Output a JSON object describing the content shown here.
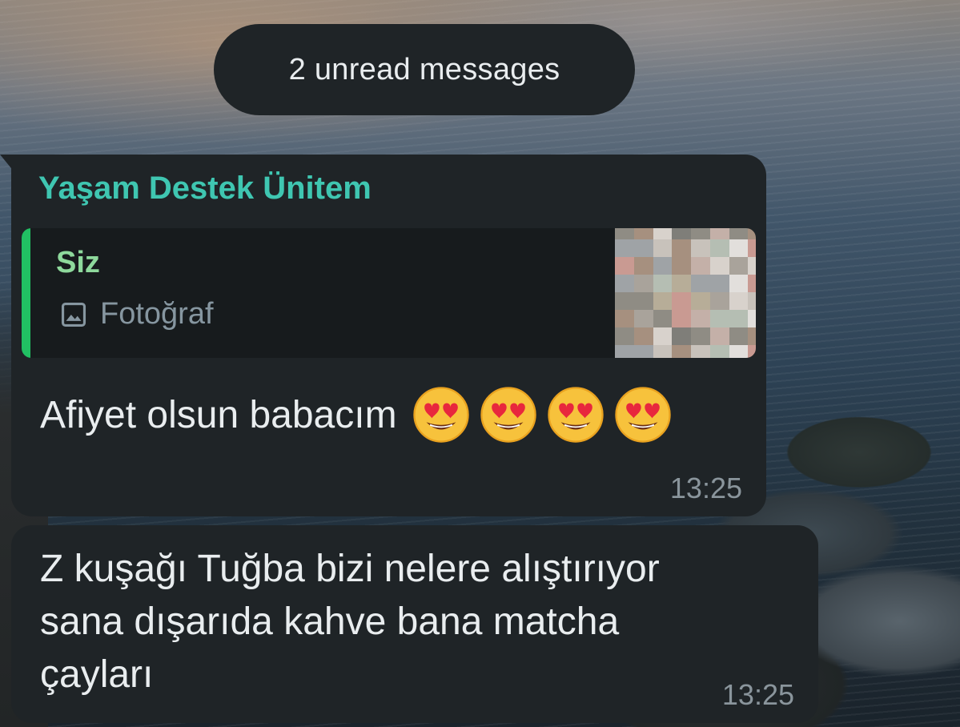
{
  "unread_banner": {
    "text": "2 unread messages"
  },
  "messages": [
    {
      "sender": "Yaşam Destek Ünitem",
      "quoted_reply": {
        "author": "Siz",
        "type_label": "Fotoğraf",
        "type_icon": "photo-icon",
        "thumbnail": "pixelated-photo"
      },
      "text": "Afiyet olsun babacım",
      "emojis": [
        "heart-eyes",
        "heart-eyes",
        "heart-eyes",
        "heart-eyes"
      ],
      "time": "13:25"
    },
    {
      "text_lines": [
        "Z kuşağı Tuğba bizi nelere alıştırıyor",
        "sana dışarıda kahve bana matcha",
        "çayları"
      ],
      "time": "13:25"
    }
  ],
  "colors": {
    "bubble": "#1f2427",
    "sender_name": "#3fc6b1",
    "quote_bar": "#21c063",
    "quote_author": "#8ed99c",
    "meta_text": "#8a959c"
  }
}
